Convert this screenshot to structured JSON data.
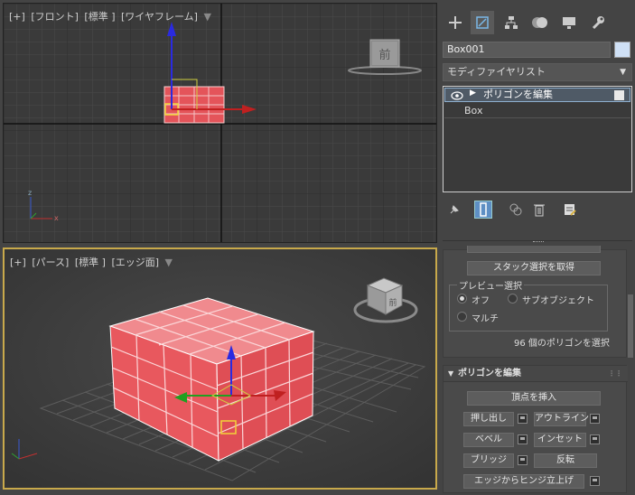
{
  "viewports": {
    "front": {
      "labels": [
        "[+]",
        "[フロント]",
        "[標準 ]",
        "[ワイヤフレーム]"
      ],
      "viewcube_label": "前"
    },
    "perspective": {
      "labels": [
        "[+]",
        "[パース]",
        "[標準 ]",
        "[エッジ面]"
      ],
      "viewcube_label": "前"
    }
  },
  "command_panel": {
    "tabs": [
      "create-icon",
      "modify-icon",
      "hierarchy-icon",
      "motion-icon",
      "display-icon",
      "utilities-icon"
    ],
    "object_name": "Box001",
    "object_color": "#cfe0f5",
    "modifier_list_label": "モディファイヤリスト",
    "stack": [
      {
        "label": "ポリゴンを編集",
        "selected": true
      },
      {
        "label": "Box",
        "selected": false
      }
    ],
    "stack_tools": [
      "pin-stack-icon",
      "show-end-result-icon",
      "make-unique-icon",
      "remove-modifier-icon",
      "configure-sets-icon"
    ]
  },
  "selection_rollout": {
    "get_stack_selection": "スタック選択を取得",
    "preview_title": "プレビュー選択",
    "options": [
      {
        "label": "オフ",
        "selected": true
      },
      {
        "label": "サブオブジェクト",
        "selected": false
      },
      {
        "label": "マルチ",
        "selected": false
      }
    ],
    "status": "96 個のポリゴンを選択"
  },
  "edit_polygons_rollout": {
    "title": "ポリゴンを編集",
    "insert_vertex": "頂点を挿入",
    "buttons": [
      {
        "label": "押し出し",
        "settings": true
      },
      {
        "label": "アウトライン",
        "settings": true
      },
      {
        "label": "ベベル",
        "settings": true
      },
      {
        "label": "インセット",
        "settings": true
      },
      {
        "label": "ブリッジ",
        "settings": true
      },
      {
        "label": "反転",
        "settings": false
      }
    ],
    "hinge": "エッジからヒンジ立上げ"
  },
  "colors": {
    "selection_red": "#e8585e",
    "viewport_active_border": "#c8a94b",
    "accent_blue": "#5e8fc4"
  }
}
